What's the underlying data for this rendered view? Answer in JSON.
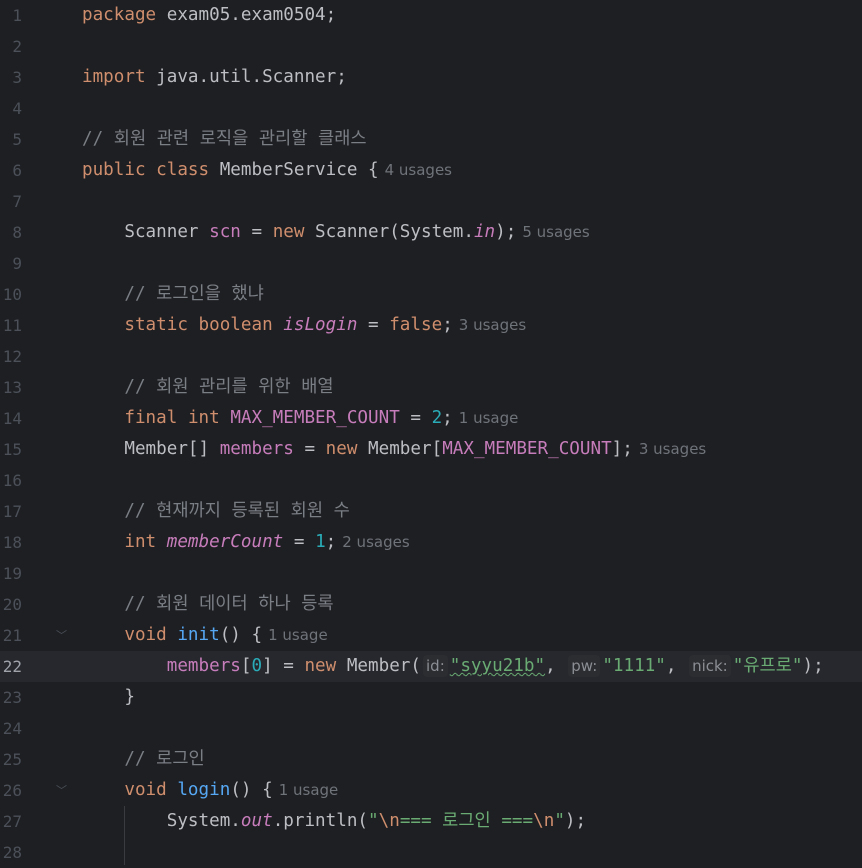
{
  "editor": {
    "line_numbers": [
      "1",
      "2",
      "3",
      "4",
      "5",
      "6",
      "7",
      "8",
      "9",
      "10",
      "11",
      "12",
      "13",
      "14",
      "15",
      "16",
      "17",
      "18",
      "19",
      "20",
      "21",
      "22",
      "23",
      "24",
      "25",
      "26",
      "27",
      "28"
    ],
    "current_line": "22",
    "colors": {
      "background": "#1e1f22",
      "keyword": "#cf8e6d",
      "field": "#c77dbb",
      "number": "#2aacb8",
      "string": "#6aab73",
      "comment": "#7a7e85",
      "method": "#56a8f5",
      "text": "#bcbec4"
    },
    "code": {
      "l1": {
        "kw": "package",
        "rest": " exam05.exam0504;"
      },
      "l3": {
        "kw": "import",
        "rest": " java.util.Scanner;"
      },
      "l5": {
        "comment": "// 회원 관련 로직을 관리할 클래스"
      },
      "l6": {
        "kw1": "public",
        "kw2": "class",
        "rest": " MemberService {",
        "hint": "4 usages"
      },
      "l8": {
        "type": "Scanner",
        "field": "scn",
        "eq": " = ",
        "kw": "new",
        "ctor": " Scanner(System.",
        "static_field": "in",
        "end": ");",
        "hint": "5 usages"
      },
      "l10": {
        "comment": "// 로그인을 했냐"
      },
      "l11": {
        "kw1": "static",
        "kw2": "boolean",
        "field": "isLogin",
        "eq": " = ",
        "val": "false",
        "end": ";",
        "hint": "3 usages"
      },
      "l13": {
        "comment": "// 회원 관리를 위한 배열"
      },
      "l14": {
        "kw1": "final",
        "kw2": "int",
        "field": "MAX_MEMBER_COUNT",
        "eq": " = ",
        "num": "2",
        "end": ";",
        "hint": "1 usage"
      },
      "l15": {
        "type": "Member[]",
        "field": "members",
        "eq": " = ",
        "kw": "new",
        "ctor": " Member[",
        "field2": "MAX_MEMBER_COUNT",
        "end": "];",
        "hint": "3 usages"
      },
      "l17": {
        "comment": "// 현재까지 등록된 회원 수"
      },
      "l18": {
        "kw": "int",
        "field": "memberCount",
        "eq": " = ",
        "num": "1",
        "end": ";",
        "hint": "2 usages"
      },
      "l20": {
        "comment": "// 회원 데이터 하나 등록"
      },
      "l21": {
        "kw": "void",
        "method": "init",
        "rest": "() {",
        "hint": "1 usage"
      },
      "l22": {
        "field": "members",
        "open": "[",
        "num": "0",
        "close": "] = ",
        "kw": "new",
        "ctor": " Member(",
        "p1": "id:",
        "s1": "\"syyu21b\"",
        "c1": ", ",
        "p2": "pw:",
        "s2": "\"1111\"",
        "c2": ", ",
        "p3": "nick:",
        "s3": "\"유프로\"",
        "end": ");"
      },
      "l23": {
        "rest": "}"
      },
      "l25": {
        "comment": "// 로그인"
      },
      "l26": {
        "kw": "void",
        "method": "login",
        "rest": "() {",
        "hint": "1 usage"
      },
      "l27": {
        "pre": "System.",
        "static_field": "out",
        "call": ".println(",
        "q1": "\"",
        "esc1": "\\n",
        "str": "=== 로그인 ===",
        "esc2": "\\n",
        "q2": "\"",
        "end": ");"
      }
    }
  }
}
